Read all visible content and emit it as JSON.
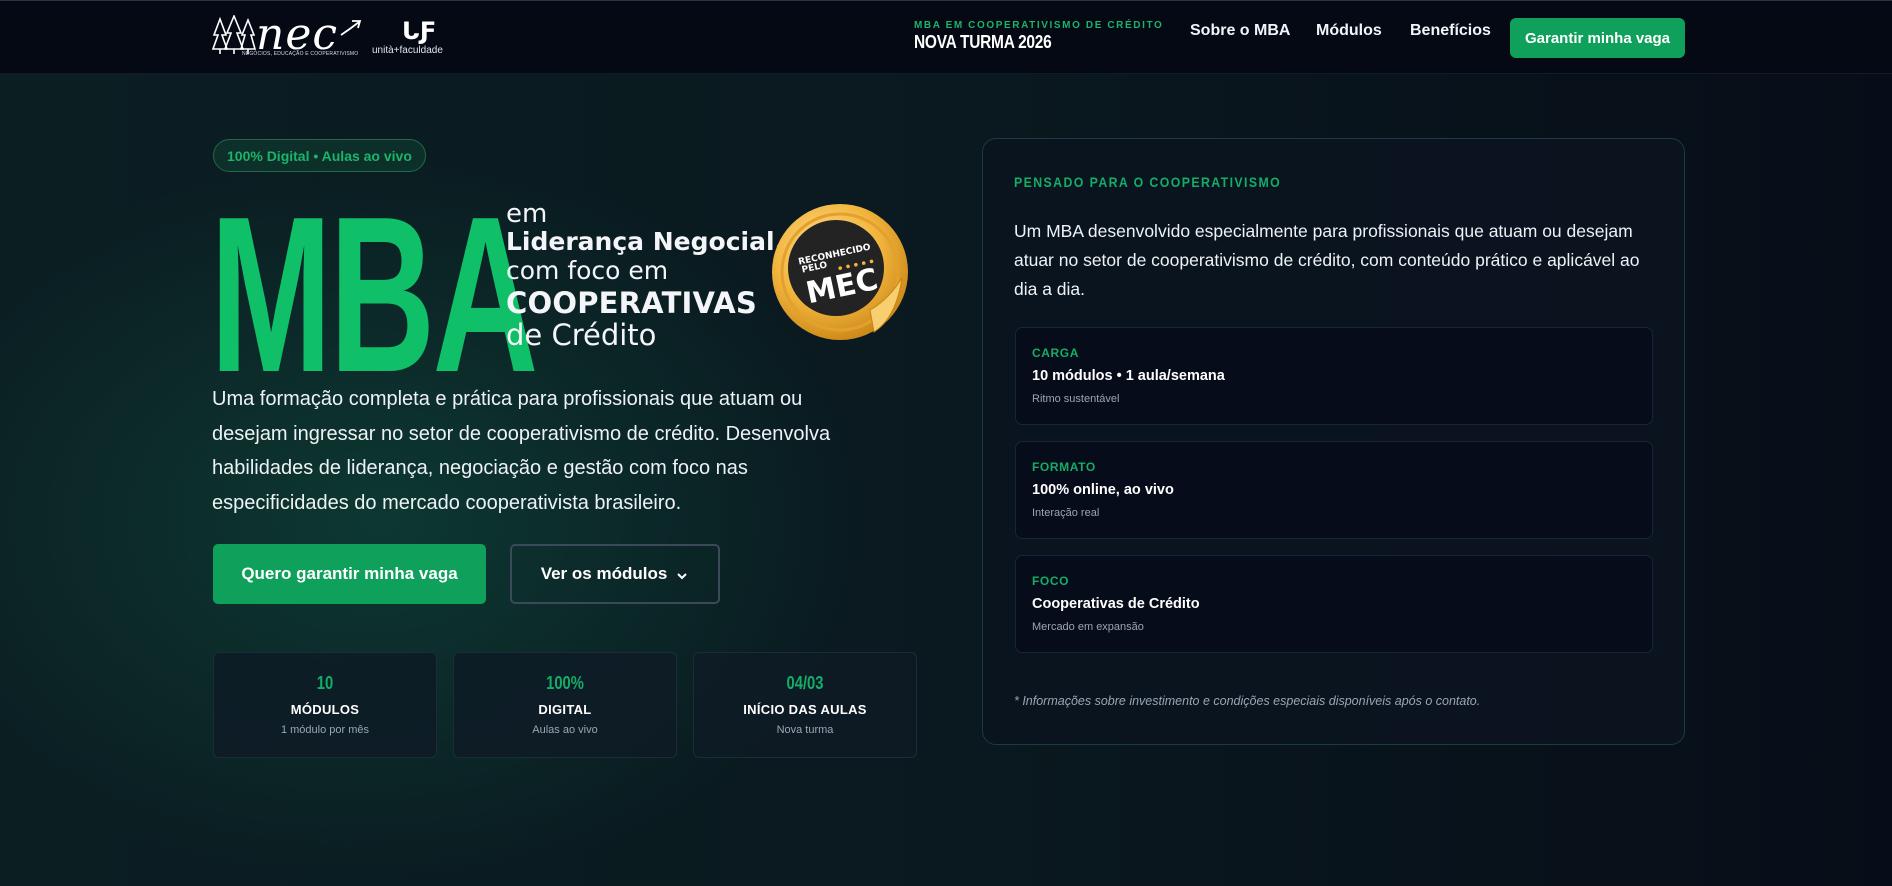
{
  "nav": {
    "brand_logo_text": "nec",
    "brand_logo_subtitle": "NEGÓCIOS, EDUCAÇÃO E COOPERATIVISMO",
    "partner_logo_text": "unità+faculdade",
    "course_label": "MBA EM COOPERATIVISMO DE CRÉDITO",
    "course_turma": "NOVA TURMA 2026",
    "links": [
      {
        "label": "Sobre o MBA"
      },
      {
        "label": "Módulos"
      },
      {
        "label": "Benefícios"
      }
    ],
    "cta_label": "Garantir minha vaga"
  },
  "hero": {
    "tag": "100% Digital • Aulas ao vivo",
    "title_big": "MBA",
    "title_line1": "em",
    "title_line2": "Liderança Negocial,",
    "title_line3": "com foco em",
    "title_line4": "COOPERATIVAS",
    "title_line5": "de Crédito",
    "seal_line1": "RECONHECIDO",
    "seal_line2": "PELO",
    "seal_line3": "MEC",
    "description": "Uma formação completa e prática para profissionais que atuam ou desejam ingressar no setor de cooperativismo de crédito. Desenvolva habilidades de liderança, negociação e gestão com foco nas especificidades do mercado cooperativista brasileiro.",
    "primary_button": "Quero garantir minha vaga",
    "secondary_button": "Ver os módulos",
    "stats": [
      {
        "value": "10",
        "label": "MÓDULOS",
        "sub": "1 módulo por mês"
      },
      {
        "value": "100%",
        "label": "DIGITAL",
        "sub": "Aulas ao vivo"
      },
      {
        "value": "04/03",
        "label": "INÍCIO DAS AULAS",
        "sub": "Nova turma"
      }
    ]
  },
  "panel": {
    "kicker": "PENSADO PARA O COOPERATIVISMO",
    "text": "Um MBA desenvolvido especialmente para profissionais que atuam ou desejam atuar no setor de cooperativismo de crédito, com conteúdo prático e aplicável ao dia a dia.",
    "features": [
      {
        "label": "CARGA",
        "title": "10 módulos • 1 aula/semana",
        "sub": "Ritmo sustentável"
      },
      {
        "label": "FORMATO",
        "title": "100% online, ao vivo",
        "sub": "Interação real"
      },
      {
        "label": "FOCO",
        "title": "Cooperativas de Crédito",
        "sub": "Mercado em expansão"
      }
    ],
    "note": "* Informações sobre investimento e condições especiais disponíveis após o contato."
  },
  "colors": {
    "accent_green": "#0fa05c",
    "title_green": "#10c069",
    "background_dark": "#040914"
  }
}
